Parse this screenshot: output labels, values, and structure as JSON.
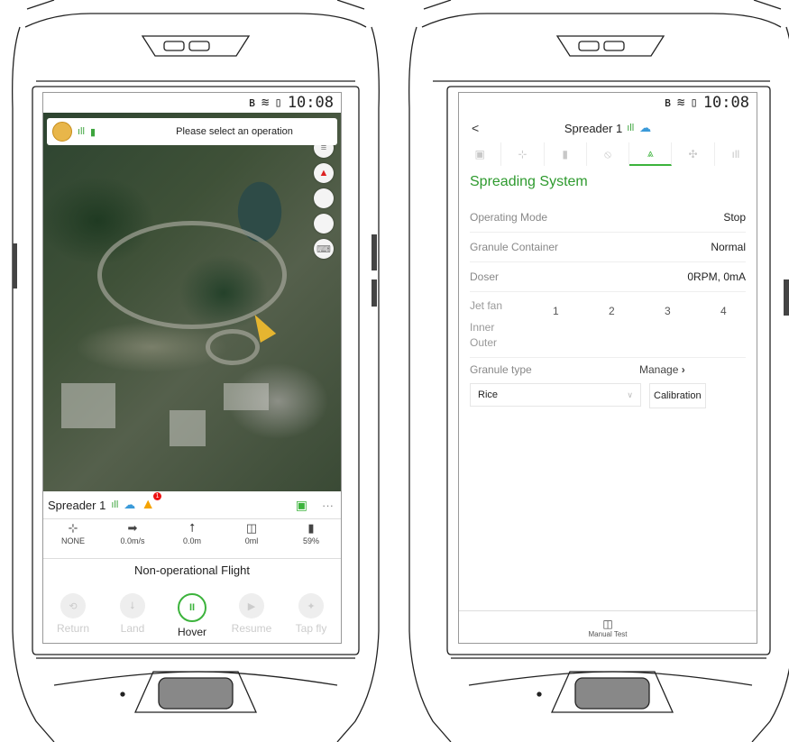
{
  "status_bar": {
    "time": "10:08",
    "icons": [
      "bluetooth-icon",
      "wifi-icon",
      "battery-icon"
    ]
  },
  "left": {
    "operation_prompt": "Please select an operation",
    "map_buttons": [
      "layers-icon",
      "compass-icon",
      "locate-icon",
      "pin-icon",
      "keyboard-icon"
    ],
    "drone_name": "Spreader 1",
    "warning_count": "1",
    "more_label": "···",
    "stats": [
      {
        "icon": "satellite-icon",
        "value": "NONE"
      },
      {
        "icon": "horizontal-speed-icon",
        "value": "0.0m/s"
      },
      {
        "icon": "altitude-icon",
        "value": "0.0m"
      },
      {
        "icon": "container-icon",
        "value": "0ml"
      },
      {
        "icon": "battery-icon",
        "value": "59%"
      }
    ],
    "flight_mode": "Non-operational Flight",
    "controls": [
      {
        "label": "Return",
        "icon": "return-icon",
        "active": false
      },
      {
        "label": "Land",
        "icon": "land-icon",
        "active": false
      },
      {
        "label": "Hover",
        "icon": "pause-icon",
        "active": true
      },
      {
        "label": "Resume",
        "icon": "resume-icon",
        "active": false
      },
      {
        "label": "Tap fly",
        "icon": "tap-fly-icon",
        "active": false
      }
    ]
  },
  "right": {
    "back": "<",
    "title": "Spreader 1",
    "tabs": [
      "rc-icon",
      "satellite-icon",
      "battery-icon",
      "sensor-icon",
      "spreader-icon",
      "motor-icon",
      "signal-icon"
    ],
    "active_tab": 4,
    "section_title": "Spreading System",
    "rows": [
      {
        "label": "Operating Mode",
        "value": "Stop"
      },
      {
        "label": "Granule Container",
        "value": "Normal"
      },
      {
        "label": "Doser",
        "value": "0RPM, 0mA"
      }
    ],
    "jet_fan": {
      "label": "Jet fan",
      "columns": [
        "1",
        "2",
        "3",
        "4"
      ],
      "inner": "Inner",
      "outer": "Outer"
    },
    "granule_type_label": "Granule type",
    "manage_label": "Manage",
    "granule_value": "Rice",
    "calibration_label": "Calibration",
    "manual_test_label": "Manual Test"
  },
  "colors": {
    "accent": "#3cb33c",
    "warning": "#f5a300",
    "cloud": "#3a9ad9"
  }
}
